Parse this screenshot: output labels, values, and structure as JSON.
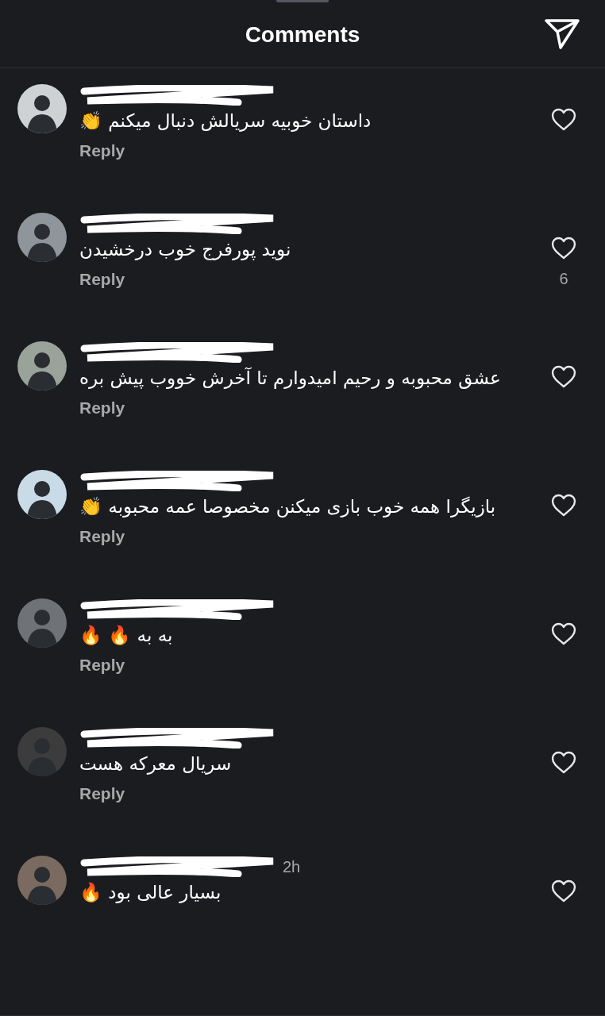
{
  "header": {
    "title": "Comments"
  },
  "comments": [
    {
      "text": "داستان خوبیه سریالش دنبال میکنم 👏",
      "reply": "Reply"
    },
    {
      "text": "نوید پورفرج خوب درخشیدن",
      "reply": "Reply",
      "likes": "6"
    },
    {
      "text": "عشق محبوبه و رحیم امیدوارم تا آخرش خووب پیش بره",
      "reply": "Reply"
    },
    {
      "text": "بازیگرا همه خوب بازی میکنن مخصوصا عمه محبوبه 👏",
      "reply": "Reply"
    },
    {
      "text": "به به 🔥 🔥",
      "reply": "Reply"
    },
    {
      "text": "سریال معرکه هست",
      "reply": "Reply"
    },
    {
      "time": "2h",
      "text": "بسیار عالی بود 🔥"
    }
  ]
}
